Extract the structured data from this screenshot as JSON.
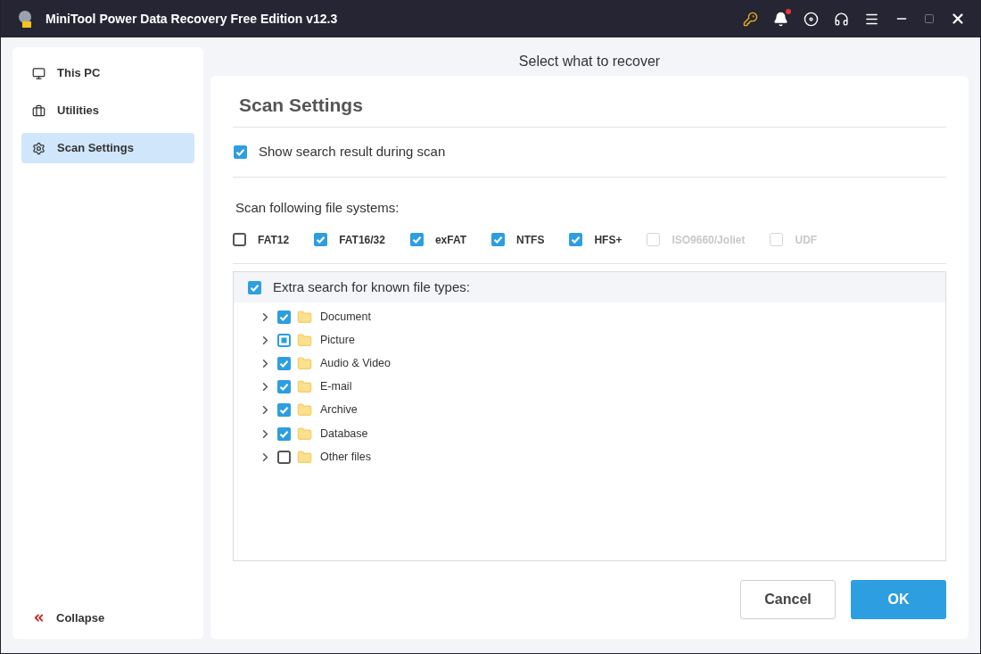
{
  "window": {
    "title": "MiniTool Power Data Recovery Free Edition v12.3",
    "has_notification": true
  },
  "sidebar": {
    "items": [
      {
        "label": "This PC",
        "selected": false
      },
      {
        "label": "Utilities",
        "selected": false
      },
      {
        "label": "Scan Settings",
        "selected": true
      }
    ],
    "collapse": "Collapse"
  },
  "header": "Select what to recover",
  "settings": {
    "title": "Scan Settings",
    "show_results": {
      "label": "Show search result during scan",
      "checked": true
    },
    "fs_label": "Scan following file systems:",
    "file_systems": [
      {
        "label": "FAT12",
        "checked": false,
        "disabled": false
      },
      {
        "label": "FAT16/32",
        "checked": true,
        "disabled": false
      },
      {
        "label": "exFAT",
        "checked": true,
        "disabled": false
      },
      {
        "label": "NTFS",
        "checked": true,
        "disabled": false
      },
      {
        "label": "HFS+",
        "checked": true,
        "disabled": false
      },
      {
        "label": "ISO9660/Joliet",
        "disabled": true
      },
      {
        "label": "UDF",
        "disabled": true
      }
    ],
    "extra": {
      "label": "Extra search for known file types:",
      "checked": true
    },
    "file_types": [
      {
        "label": "Document",
        "checked": true,
        "partial": false,
        "expanded": false
      },
      {
        "label": "Picture",
        "checked": false,
        "partial": true,
        "expanded": false
      },
      {
        "label": "Audio & Video",
        "checked": true,
        "partial": false,
        "expanded": false
      },
      {
        "label": "E-mail",
        "checked": true,
        "partial": false,
        "expanded": false
      },
      {
        "label": "Archive",
        "checked": true,
        "partial": false,
        "expanded": false
      },
      {
        "label": "Database",
        "checked": true,
        "partial": false,
        "expanded": false
      },
      {
        "label": "Other files",
        "checked": false,
        "partial": false,
        "expanded": false
      }
    ]
  },
  "buttons": [
    {
      "label": "Cancel",
      "kind": "secondary"
    },
    {
      "label": "OK",
      "kind": "primary"
    }
  ]
}
